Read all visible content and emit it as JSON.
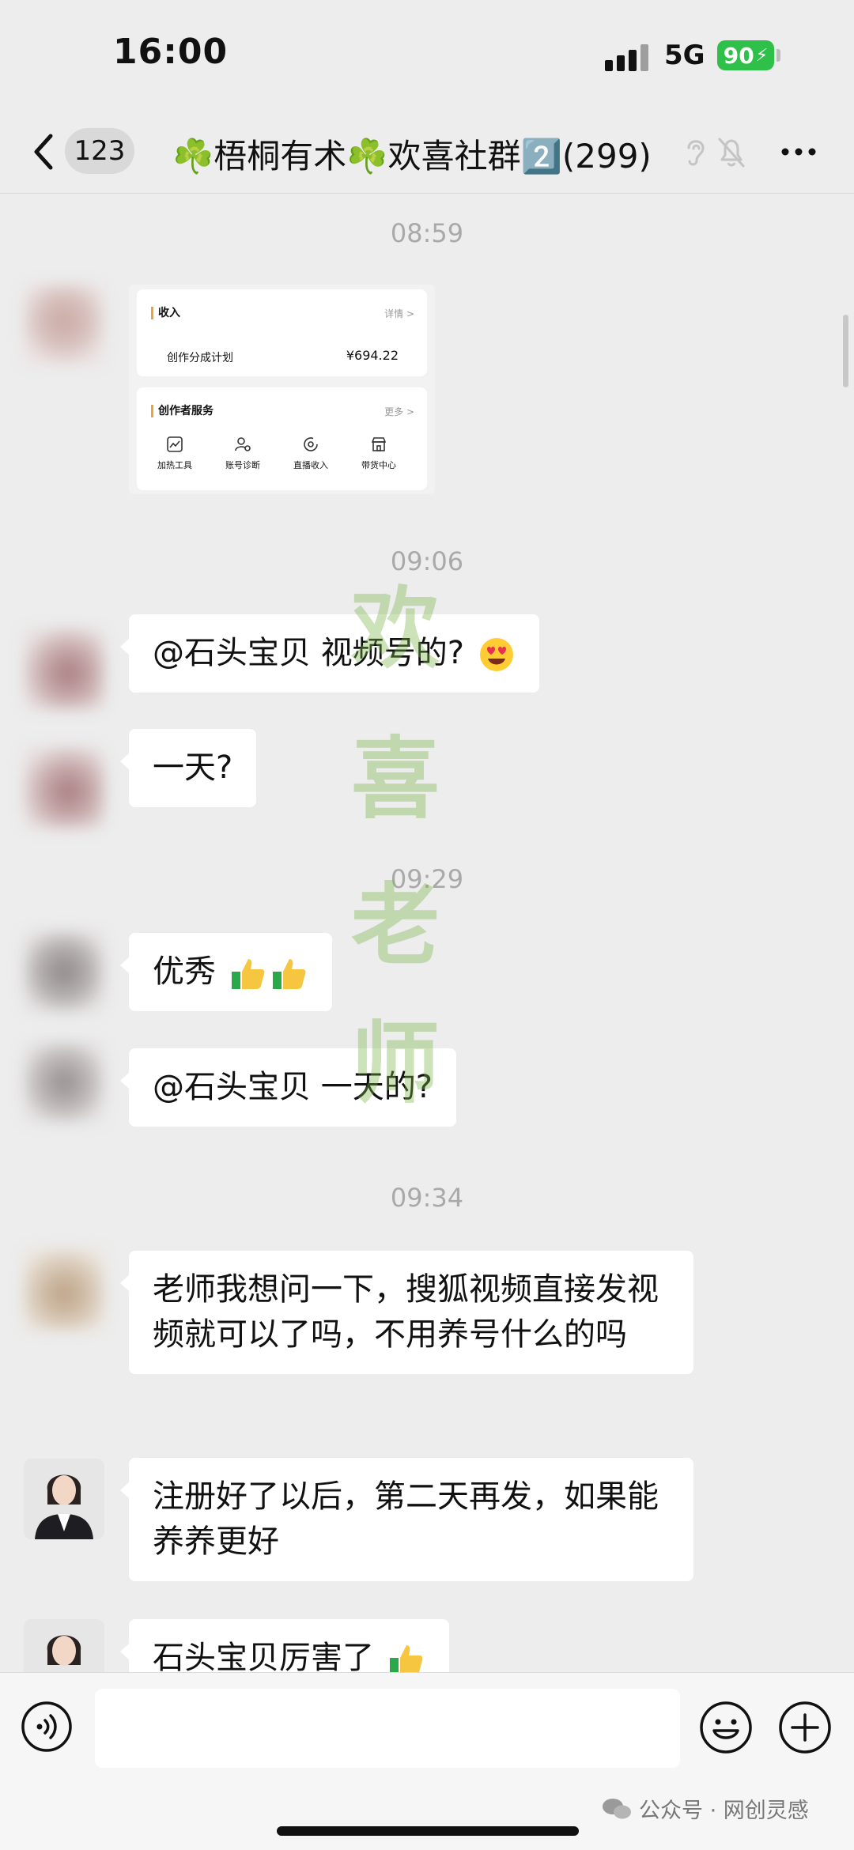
{
  "status_bar": {
    "time": "16:00",
    "network": "5G",
    "battery": "90"
  },
  "nav": {
    "back_count": "123",
    "title": "☘️梧桐有术☘️欢喜社群2️⃣(299)",
    "icons": [
      "back-icon",
      "ear-icon",
      "mute-icon",
      "more-icon"
    ]
  },
  "messages": {
    "t1": "08:59",
    "t2": "09:06",
    "t3": "09:29",
    "t4": "09:34",
    "m1": "@石头宝贝 视频号的?",
    "m2": "一天?",
    "m3": "优秀",
    "m4": "@石头宝贝 一天的?",
    "m5": "老师我想问一下，搜狐视频直接发视频就可以了吗，不用养号什么的吗",
    "m6": "注册好了以后，第二天再发，如果能养养更好",
    "m7": "石头宝贝厉害了"
  },
  "screenshot_card": {
    "income_title": "收入",
    "income_link": "详情 >",
    "income_label": "创作分成计划",
    "income_value": "¥694.22",
    "service_title": "创作者服务",
    "service_link": "更多 >",
    "services": [
      "加热工具",
      "账号诊断",
      "直播收入",
      "带货中心"
    ]
  },
  "watermark": [
    "欢",
    "喜",
    "老",
    "师"
  ],
  "input": {
    "placeholder": ""
  },
  "footer": {
    "account_caption": "公众号 · 网创灵感"
  },
  "colors": {
    "battery": "#2fc04a",
    "background": "#ededed",
    "bubble": "#ffffff",
    "accent": "#f2a23a"
  }
}
